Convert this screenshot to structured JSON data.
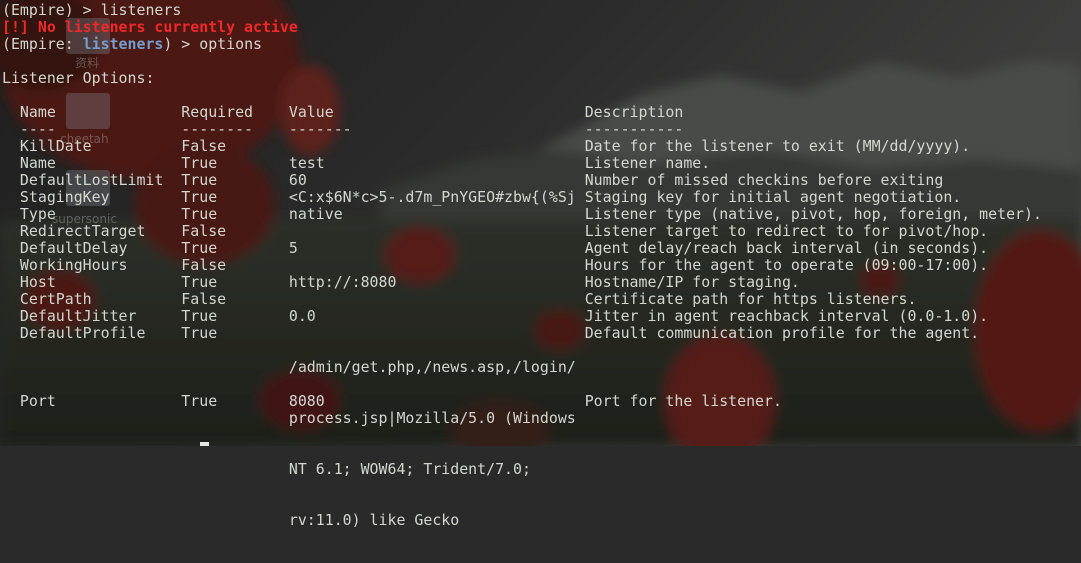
{
  "session": {
    "prompt1": {
      "prompt": "(Empire) > ",
      "command": "listeners"
    },
    "error_message": "[!] No listeners currently active",
    "prompt2": {
      "prefix": "(Empire: ",
      "module": "listeners",
      "suffix": ") > ",
      "command": "options"
    },
    "options_heading": "Listener Options:"
  },
  "options_table": {
    "headers": {
      "name": "Name",
      "required": "Required",
      "value": "Value",
      "description": "Description"
    },
    "underlines": {
      "name": "----",
      "required": "--------",
      "value": "-------",
      "description": "-----------"
    },
    "rows": [
      {
        "name": "KillDate",
        "required": "False",
        "value": [],
        "description": "Date for the listener to exit (MM/dd/yyyy)."
      },
      {
        "name": "Name",
        "required": "True",
        "value": [
          "test"
        ],
        "description": "Listener name."
      },
      {
        "name": "DefaultLostLimit",
        "required": "True",
        "value": [
          "60"
        ],
        "description": "Number of missed checkins before exiting"
      },
      {
        "name": "StagingKey",
        "required": "True",
        "value": [
          "<C:x$6N*c>5-.d7m_PnYGEO#zbw{(%Sj"
        ],
        "description": "Staging key for initial agent negotiation."
      },
      {
        "name": "Type",
        "required": "True",
        "value": [
          "native"
        ],
        "description": "Listener type (native, pivot, hop, foreign, meter)."
      },
      {
        "name": "RedirectTarget",
        "required": "False",
        "value": [],
        "description": "Listener target to redirect to for pivot/hop."
      },
      {
        "name": "DefaultDelay",
        "required": "True",
        "value": [
          "5"
        ],
        "description": "Agent delay/reach back interval (in seconds)."
      },
      {
        "name": "WorkingHours",
        "required": "False",
        "value": [],
        "description": "Hours for the agent to operate (09:00-17:00)."
      },
      {
        "name": "Host",
        "required": "True",
        "value": [
          "http://:8080"
        ],
        "description": "Hostname/IP for staging."
      },
      {
        "name": "CertPath",
        "required": "False",
        "value": [],
        "description": "Certificate path for https listeners."
      },
      {
        "name": "DefaultJitter",
        "required": "True",
        "value": [
          "0.0"
        ],
        "description": "Jitter in agent reachback interval (0.0-1.0)."
      },
      {
        "name": "DefaultProfile",
        "required": "True",
        "value": [
          "/admin/get.php,/news.asp,/login/",
          "process.jsp|Mozilla/5.0 (Windows",
          "NT 6.1; WOW64; Trident/7.0;",
          "rv:11.0) like Gecko"
        ],
        "description": "Default communication profile for the agent."
      },
      {
        "name": "Port",
        "required": "True",
        "value": [
          "8080"
        ],
        "description": "Port for the listener."
      }
    ]
  },
  "desktop_icons": [
    {
      "label": "资料",
      "icon": "folder-icon"
    },
    {
      "label": "cheetah",
      "icon": "file-icon"
    },
    {
      "label": "supersonic",
      "icon": "file-icon"
    }
  ],
  "colors": {
    "terminal_text": "#d3d7cf",
    "error_text": "#ef2929",
    "module_name": "#729fcf"
  }
}
